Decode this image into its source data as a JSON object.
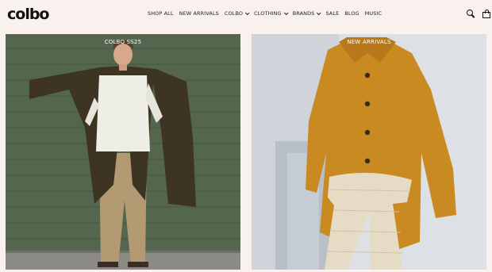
{
  "brand": {
    "logo_text": "colbo"
  },
  "nav": {
    "items": [
      {
        "label": "SHOP ALL",
        "dropdown": false
      },
      {
        "label": "NEW ARRIVALS",
        "dropdown": false
      },
      {
        "label": "COLBO",
        "dropdown": true
      },
      {
        "label": "CLOTHING",
        "dropdown": true
      },
      {
        "label": "BRANDS",
        "dropdown": true
      },
      {
        "label": "SALE",
        "dropdown": false
      },
      {
        "label": "BLOG",
        "dropdown": false
      },
      {
        "label": "MUSIC",
        "dropdown": false
      }
    ]
  },
  "header_icons": [
    "search-icon",
    "bag-icon"
  ],
  "cards": [
    {
      "label": "COLBO SS25"
    },
    {
      "label": "NEW ARRIVALS"
    }
  ],
  "colors": {
    "background": "#f8f1ee",
    "card1_backdrop": "#5a6a58",
    "card2_backdrop": "#e3e6ea",
    "coat_brown": "#3e3424",
    "coat_mustard": "#c98a22"
  }
}
